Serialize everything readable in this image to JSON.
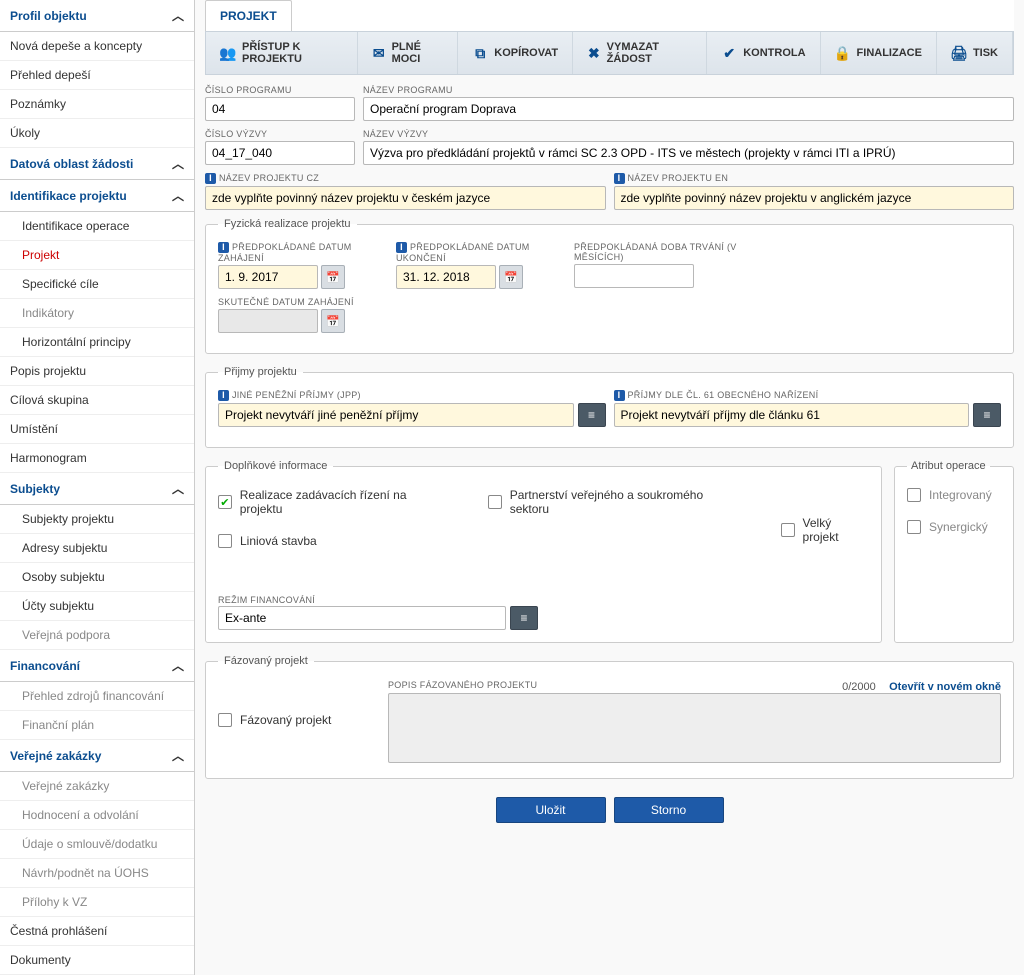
{
  "sidebar": {
    "profil_header": "Profil objektu",
    "items_profil": [
      "Nová depeše a koncepty",
      "Přehled depeší",
      "Poznámky",
      "Úkoly"
    ],
    "datova_header": "Datová oblast žádosti",
    "ident_header": "Identifikace projektu",
    "ident_items": [
      "Identifikace operace",
      "Projekt",
      "Specifické cíle",
      "Indikátory",
      "Horizontální principy"
    ],
    "popis": "Popis projektu",
    "cilova": "Cílová skupina",
    "umisteni": "Umístění",
    "harmon": "Harmonogram",
    "subjekty_header": "Subjekty",
    "subjekty_items": [
      "Subjekty projektu",
      "Adresy subjektu",
      "Osoby subjektu",
      "Účty subjektu",
      "Veřejná podpora"
    ],
    "financ_header": "Financování",
    "financ_items": [
      "Přehled zdrojů financování",
      "Finanční plán"
    ],
    "vz_header": "Veřejné zakázky",
    "vz_items": [
      "Veřejné zakázky",
      "Hodnocení a odvolání",
      "Údaje o smlouvě/dodatku",
      "Návrh/podnět na ÚOHS",
      "Přílohy k VZ"
    ],
    "cestna": "Čestná prohlášení",
    "dokumenty": "Dokumenty"
  },
  "tab": {
    "projekt": "PROJEKT"
  },
  "toolbar": {
    "pristup": "PŘÍSTUP K PROJEKTU",
    "plne_moci": "PLNÉ MOCI",
    "kopirovat": "KOPÍROVAT",
    "vymazat": "VYMAZAT ŽÁDOST",
    "kontrola": "KONTROLA",
    "finalizace": "FINALIZACE",
    "tisk": "TISK"
  },
  "fields": {
    "cislo_programu_lbl": "ČÍSLO PROGRAMU",
    "cislo_programu_val": "04",
    "nazev_programu_lbl": "NÁZEV PROGRAMU",
    "nazev_programu_val": "Operační program Doprava",
    "cislo_vyzvy_lbl": "ČÍSLO VÝZVY",
    "cislo_vyzvy_val": "04_17_040",
    "nazev_vyzvy_lbl": "NÁZEV VÝZVY",
    "nazev_vyzvy_val": "Výzva pro předkládání projektů v rámci SC 2.3 OPD - ITS ve městech (projekty v rámci ITI a IPRÚ)",
    "nazev_cz_lbl": "NÁZEV PROJEKTU CZ",
    "nazev_cz_val": "zde vyplňte povinný název projektu v českém jazyce",
    "nazev_en_lbl": "NÁZEV PROJEKTU EN",
    "nazev_en_val": "zde vyplňte povinný název projektu v anglickém jazyce"
  },
  "fyzicka": {
    "legend": "Fyzická realizace projektu",
    "zahajeni_lbl": "PŘEDPOKLÁDANÉ DATUM ZAHÁJENÍ",
    "zahajeni_val": "1. 9. 2017",
    "ukonceni_lbl": "PŘEDPOKLÁDANÉ DATUM UKONČENÍ",
    "ukonceni_val": "31. 12. 2018",
    "doba_lbl": "PŘEDPOKLÁDANÁ DOBA TRVÁNÍ (V MĚSÍCÍCH)",
    "skutecne_lbl": "SKUTEČNÉ DATUM ZAHÁJENÍ"
  },
  "prijmy": {
    "legend": "Přijmy projektu",
    "jpp_lbl": "JINÉ PENĚŽNÍ PŘÍJMY (JPP)",
    "jpp_val": "Projekt nevytváří jiné peněžní příjmy",
    "cl61_lbl": "PŘÍJMY DLE ČL. 61 OBECNÉHO NAŘÍZENÍ",
    "cl61_val": "Projekt nevytváří příjmy dle článku 61"
  },
  "doplnkove": {
    "legend": "Doplňkové informace",
    "realizace": "Realizace zadávacích řízení na projektu",
    "liniova": "Liniová stavba",
    "partnerstvi": "Partnerství veřejného a soukromého sektoru",
    "velky": "Velký projekt",
    "rezim_lbl": "REŽIM FINANCOVÁNÍ",
    "rezim_val": "Ex-ante"
  },
  "atribut": {
    "legend": "Atribut operace",
    "integrovany": "Integrovaný",
    "synergicky": "Synergický"
  },
  "fazovany": {
    "legend": "Fázovaný projekt",
    "chk_label": "Fázovaný projekt",
    "popis_lbl": "POPIS FÁZOVANÉHO PROJEKTU",
    "counter": "0/2000",
    "newwin": "Otevřít v novém okně"
  },
  "buttons": {
    "ulozit": "Uložit",
    "storno": "Storno"
  }
}
